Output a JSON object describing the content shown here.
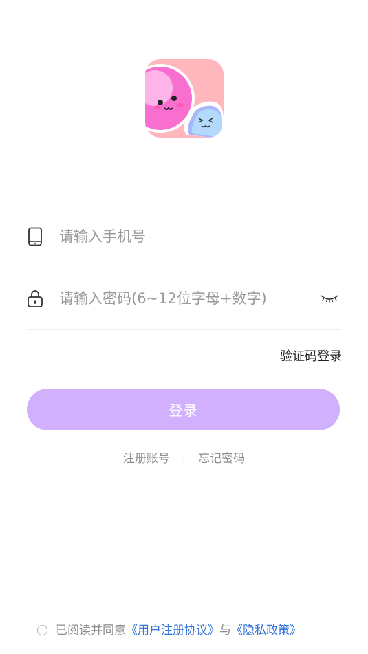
{
  "app": {
    "logo_icon": "cute-blobs-app-logo"
  },
  "phone_field": {
    "icon": "phone-icon",
    "placeholder": "请输入手机号",
    "value": ""
  },
  "password_field": {
    "icon": "lock-icon",
    "placeholder": "请输入密码(6~12位字母+数字)",
    "value": "",
    "toggle_icon": "eye-closed-icon"
  },
  "code_login_label": "验证码登录",
  "login_button_label": "登录",
  "links": {
    "register": "注册账号",
    "separator": "|",
    "forgot_password": "忘记密码"
  },
  "agreement": {
    "checked": false,
    "prefix": "已阅读并同意",
    "user_agreement": "《用户注册协议》",
    "connector": "与",
    "privacy_policy": "《隐私政策》"
  },
  "colors": {
    "primary_button": "#d1b1fe",
    "link": "#2f72d9",
    "muted_text": "#8c8c8c",
    "logo_bg": "#ffb7bd"
  }
}
